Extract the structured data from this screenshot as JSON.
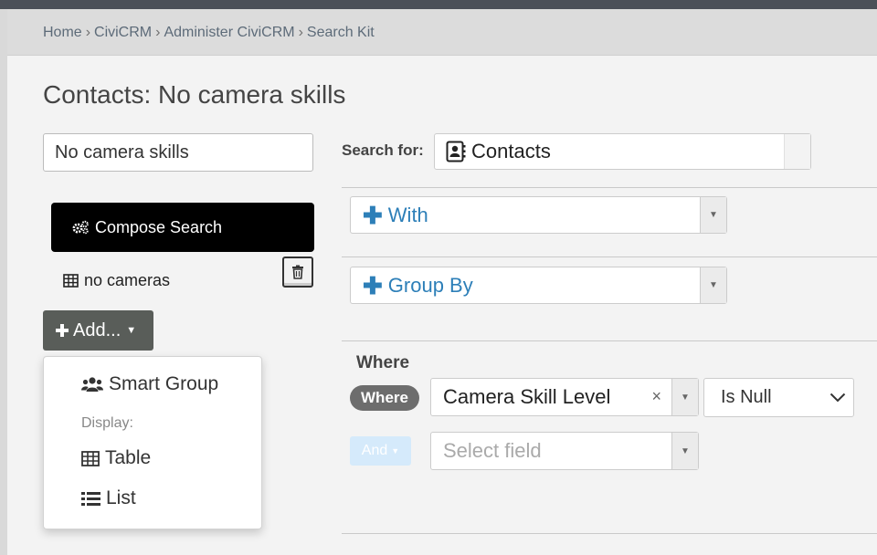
{
  "breadcrumb": {
    "items": [
      "Home",
      "CiviCRM",
      "Administer CiviCRM",
      "Search Kit"
    ],
    "separator": "›"
  },
  "page_title": "Contacts: No camera skills",
  "sidebar": {
    "search_name_value": "No camera skills",
    "compose_label": "Compose Search",
    "displays": [
      {
        "label": "no cameras",
        "icon": "table-icon"
      }
    ],
    "add_label": "Add...",
    "add_menu": {
      "smart_group_label": "Smart Group",
      "display_header": "Display:",
      "table_label": "Table",
      "list_label": "List"
    }
  },
  "main": {
    "search_for_label": "Search for:",
    "entity_value": "Contacts",
    "with_label": "With",
    "group_by_label": "Group By",
    "where_heading": "Where",
    "where_badge": "Where",
    "condition": {
      "field": "Camera Skill Level",
      "clear_icon": "×",
      "operator": "Is Null"
    },
    "and_label": "And",
    "select_field_placeholder": "Select field"
  },
  "colors": {
    "link_blue": "#2d7fb8",
    "compose_bg": "#000000",
    "add_button_bg": "#595d59",
    "where_badge_bg": "#6d6d6d",
    "and_button_bg": "#d5eafb"
  }
}
